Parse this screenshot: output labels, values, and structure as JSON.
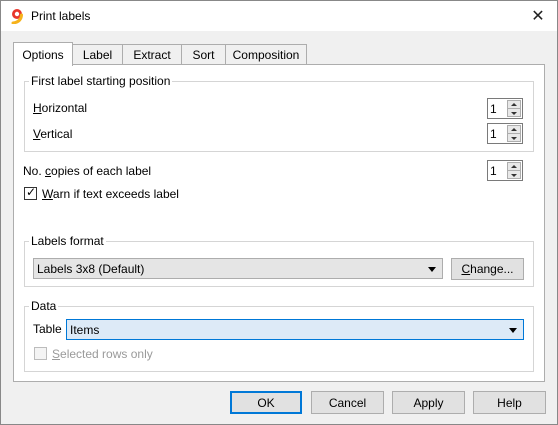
{
  "window": {
    "title": "Print labels",
    "close_glyph": "✕",
    "app_icon": "banana-app-icon"
  },
  "tabs": [
    {
      "label": "Options",
      "active": true
    },
    {
      "label": "Label",
      "active": false
    },
    {
      "label": "Extract",
      "active": false
    },
    {
      "label": "Sort",
      "active": false
    },
    {
      "label": "Composition",
      "active": false
    }
  ],
  "first_label": {
    "group_title": "First label starting position",
    "horizontal": {
      "label_ul": "H",
      "label_rest": "orizontal",
      "value": "1"
    },
    "vertical": {
      "label_ul": "V",
      "label_rest": "ertical",
      "value": "1"
    }
  },
  "copies": {
    "label_pre": "No. ",
    "label_ul": "c",
    "label_rest": "opies of each label",
    "value": "1"
  },
  "warn": {
    "label_ul": "W",
    "label_rest": "arn if text exceeds label",
    "checked": true
  },
  "labels_format": {
    "group_title": "Labels format",
    "selected": "Labels 3x8 (Default)",
    "change_ul": "C",
    "change_rest": "hange..."
  },
  "data": {
    "group_title": "Data",
    "table_label": "Table",
    "table_selected": "Items",
    "selected_rows_ul": "S",
    "selected_rows_rest": "elected rows only",
    "selected_rows_checked": false
  },
  "footer": {
    "ok": "OK",
    "cancel": "Cancel",
    "apply": "Apply",
    "help": "Help"
  },
  "colors": {
    "accent": "#0078d7",
    "focused_combo_bg": "#ddeaf7",
    "app_icon_red": "#e8362c",
    "app_icon_yellow": "#f6b21b"
  }
}
